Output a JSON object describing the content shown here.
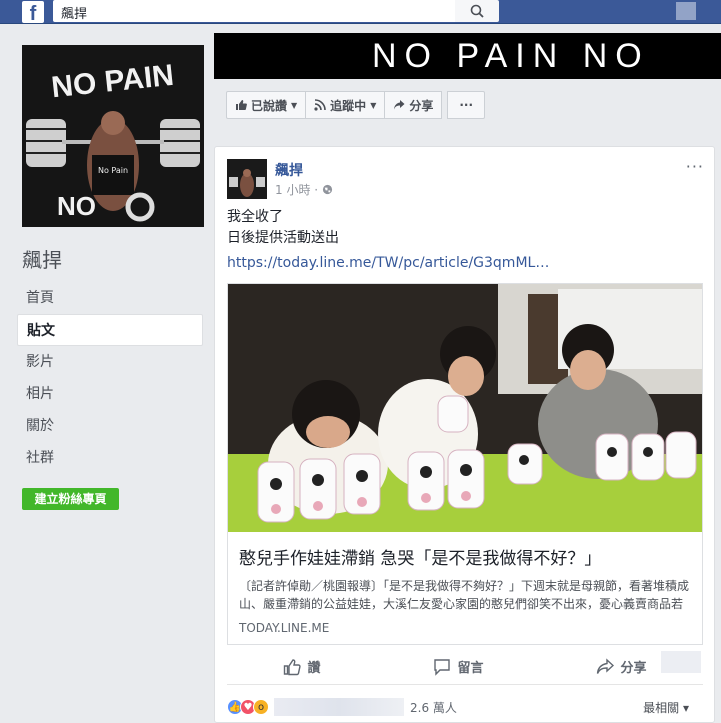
{
  "topbar": {
    "search_value": "飆捍",
    "logo": "f",
    "search_icon": "search-icon"
  },
  "page": {
    "name": "飆捍",
    "cover_text": "NO PAIN NO",
    "profile_text_top": "NO PAIN",
    "profile_text_bottom": "NO ",
    "profile_shirt_text": "No Pain"
  },
  "nav": {
    "items": [
      "首頁",
      "貼文",
      "影片",
      "相片",
      "關於",
      "社群"
    ],
    "active": "貼文"
  },
  "create_button": "建立粉絲專頁",
  "actions": {
    "liked": "已說讚",
    "following": "追蹤中",
    "share": "分享",
    "more": "···"
  },
  "post": {
    "author": "飆捍",
    "time": "1 小時 ·",
    "more": "···",
    "line1": "我全收了",
    "line2": "日後提供活動送出",
    "link": "https://today.line.me/TW/pc/article/G3qmML…",
    "card_title": "憨兒手作娃娃滯銷 急哭「是不是我做得不好？」",
    "card_desc": "〔記者許倬勛／桃園報導〕「是不是我做得不夠好？」下週末就是母親節，看著堆積成山、嚴重滯銷的公益娃娃，大溪仁友愛心家園的憨兒們卻笑不出來，憂心義賣商品若賣不出去，將失去安身立命的家，再度流落街頭。 位在.....",
    "card_domain": "TODAY.LINE.ME"
  },
  "post_actions": {
    "like": "讚",
    "comment": "留言",
    "share": "分享"
  },
  "reactions": {
    "count": "2.6 萬人",
    "sort": "最相關 ▾"
  },
  "colors": {
    "fb_blue": "#3b5998",
    "link": "#365899",
    "green": "#42b72a"
  }
}
